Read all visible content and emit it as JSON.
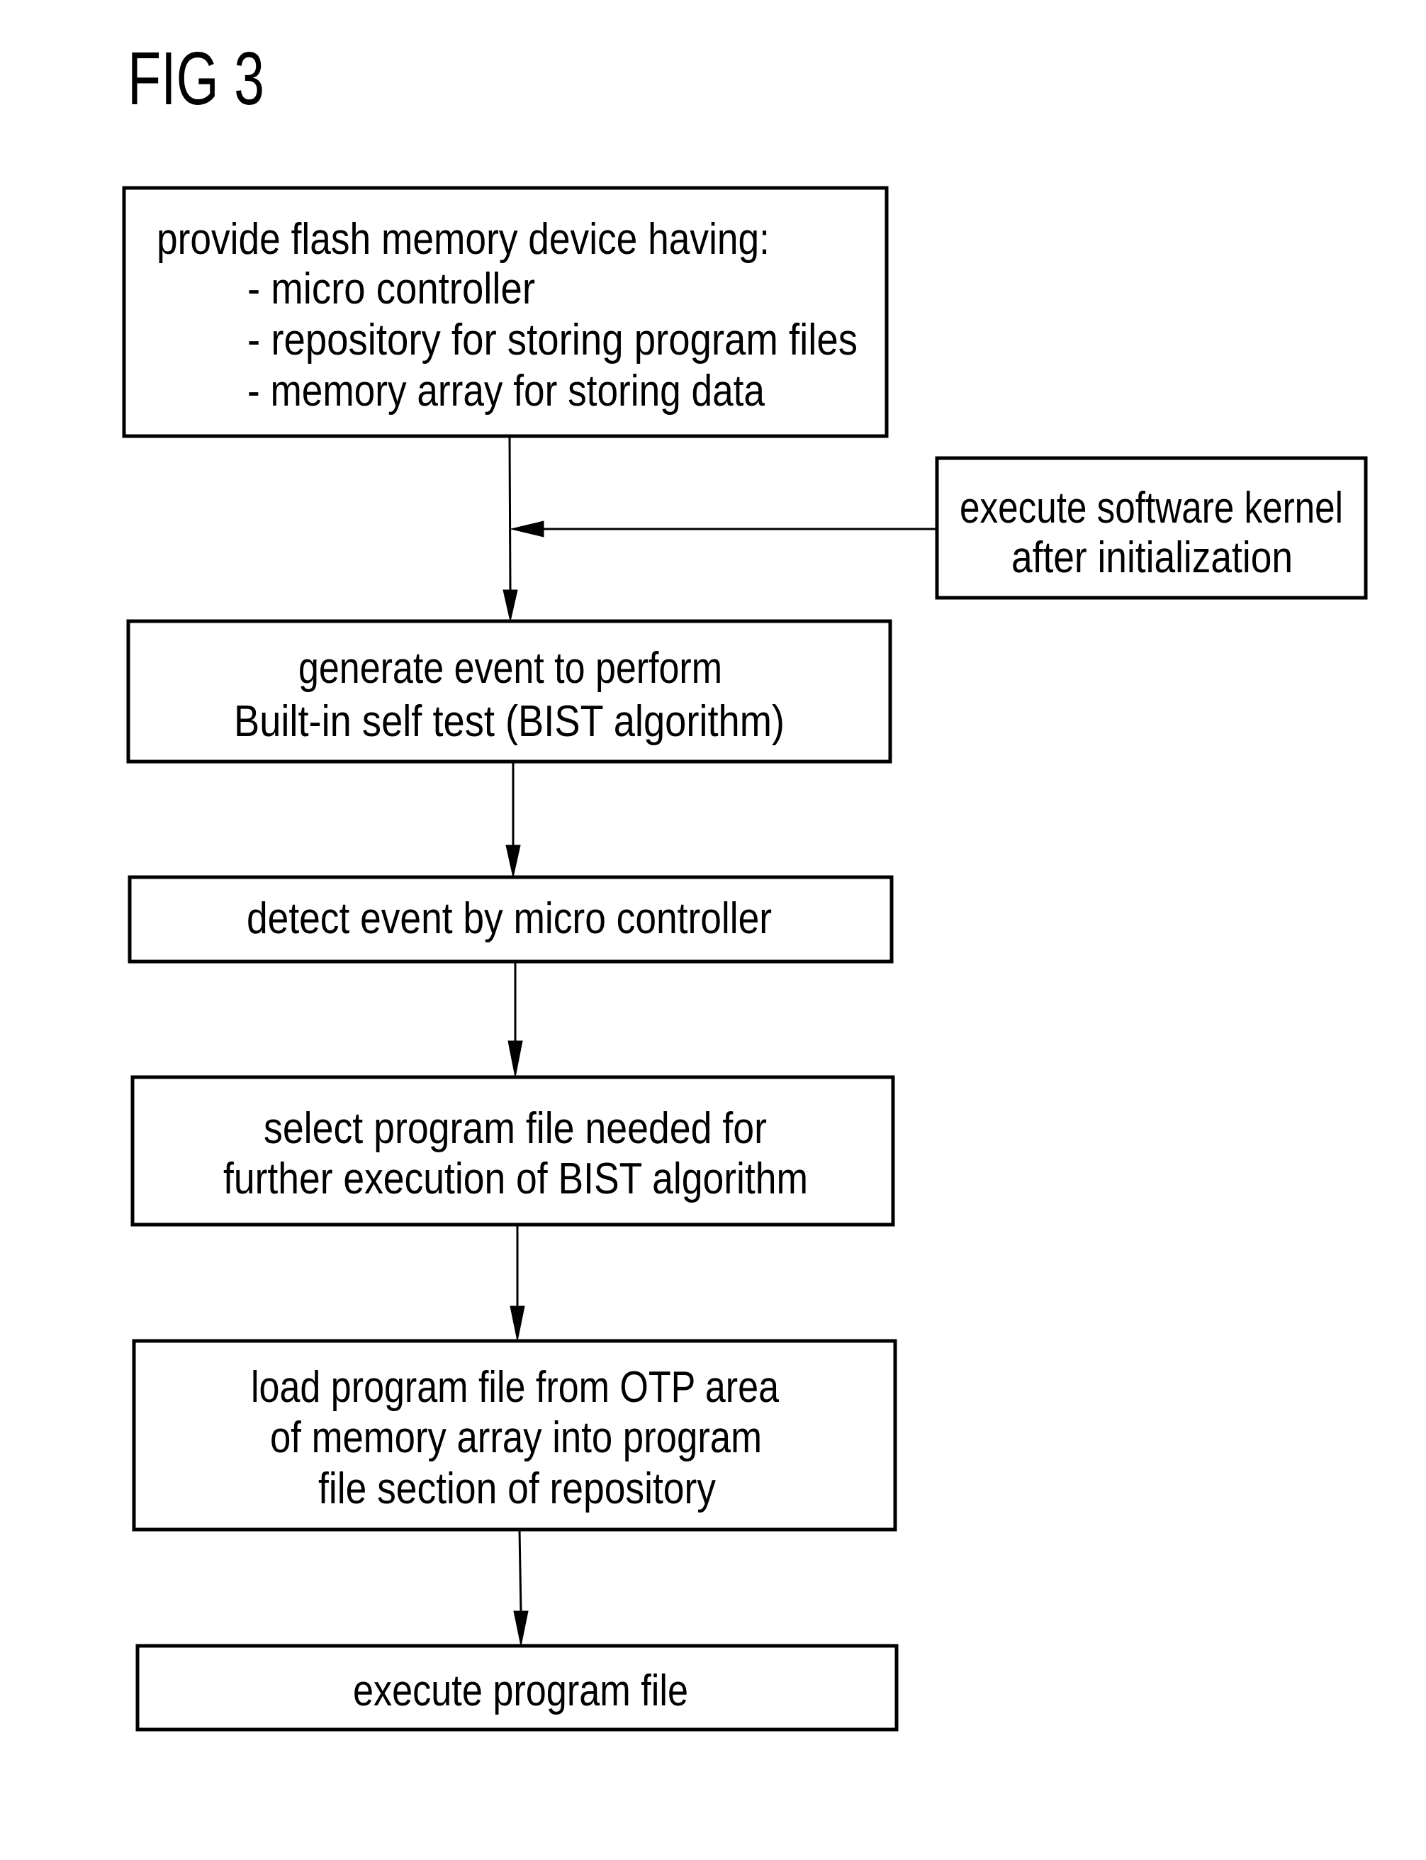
{
  "figure": {
    "title": "FIG 3",
    "line_color": "#000000",
    "background": "#ffffff"
  },
  "steps": [
    {
      "id": "provide-device",
      "lines": [
        "provide flash memory device having:",
        "- micro controller",
        "- repository for storing program files",
        "- memory array for storing data"
      ]
    },
    {
      "id": "generate-event",
      "lines": [
        "generate event to perform",
        "Built-in self test (BIST algorithm)"
      ]
    },
    {
      "id": "detect-event",
      "lines": [
        "detect event by micro controller"
      ]
    },
    {
      "id": "select-program-file",
      "lines": [
        "select program file needed for",
        "further execution of BIST algorithm"
      ]
    },
    {
      "id": "load-program-file",
      "lines": [
        "load program file from OTP area",
        "of memory array into program",
        "file section of repository"
      ]
    },
    {
      "id": "execute-program-file",
      "lines": [
        "execute program file"
      ]
    }
  ],
  "side_input": {
    "id": "execute-kernel",
    "lines": [
      "execute software kernel",
      "after initialization"
    ],
    "feeds_into": "arrow between provide-device and generate-event"
  },
  "connections": [
    {
      "from": "provide-device",
      "to": "generate-event"
    },
    {
      "from": "execute-kernel",
      "to": "provide-device→generate-event arrow"
    },
    {
      "from": "generate-event",
      "to": "detect-event"
    },
    {
      "from": "detect-event",
      "to": "select-program-file"
    },
    {
      "from": "select-program-file",
      "to": "load-program-file"
    },
    {
      "from": "load-program-file",
      "to": "execute-program-file"
    }
  ]
}
